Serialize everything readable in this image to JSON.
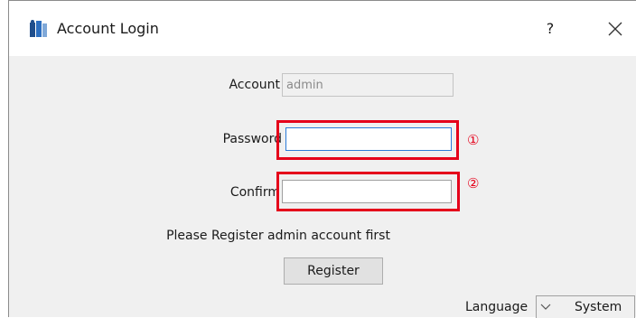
{
  "window": {
    "title": "Account Login",
    "help_label": "?",
    "close_icon": "close-icon",
    "app_icon": "app-logo-icon"
  },
  "form": {
    "account": {
      "label": "Account",
      "value": "admin"
    },
    "password": {
      "label": "Password",
      "value": ""
    },
    "confirm": {
      "label": "Confirm",
      "value": ""
    },
    "message": "Please Register admin account first",
    "register_label": "Register"
  },
  "annotations": {
    "marker_1": "①",
    "marker_2": "②",
    "highlight_color": "#e5001a"
  },
  "footer": {
    "language_label": "Language",
    "language_value": "System",
    "dropdown_icon": "chevron-down-icon"
  }
}
